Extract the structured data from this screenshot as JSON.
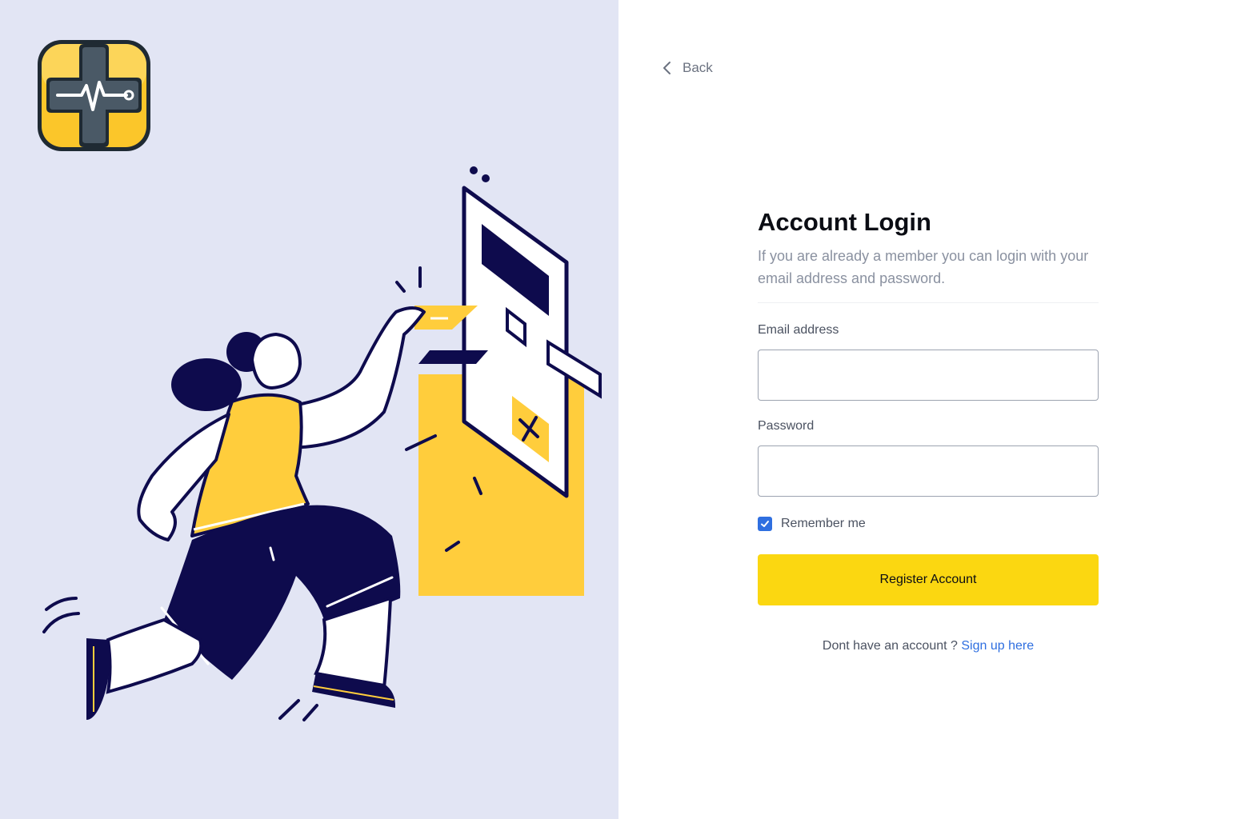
{
  "nav": {
    "back_label": "Back"
  },
  "login": {
    "title": "Account Login",
    "subtitle": "If you are already a member you can login with your email address and password.",
    "email_label": "Email address",
    "email_value": "",
    "password_label": "Password",
    "password_value": "",
    "remember_label": "Remember me",
    "remember_checked": true,
    "submit_label": "Register Account",
    "signup_prompt": "Dont have an account ?",
    "signup_link": "Sign up here"
  },
  "colors": {
    "left_panel_bg": "#e2e5f4",
    "accent_yellow": "#fbd711",
    "illustration_yellow": "#ffcd3c",
    "illustration_navy": "#0e0b4d",
    "link_blue": "#2f6fe0"
  },
  "icons": {
    "logo": "medical-cross-heartbeat-icon",
    "back": "chevron-left-icon",
    "checkbox": "check-icon"
  }
}
